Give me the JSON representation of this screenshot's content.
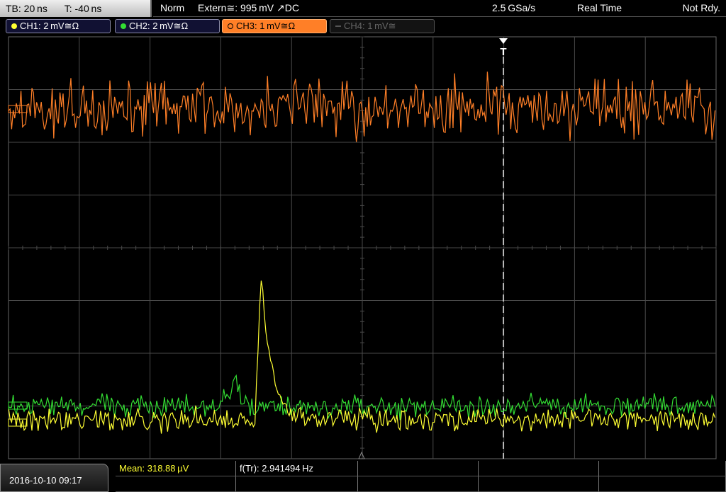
{
  "topbar": {
    "timebase": "TB: 20 ns",
    "trigger_time": "T: -40 ns",
    "mode": "Norm",
    "trigger": "Extern≅: 995 mV ↗DC",
    "sample_rate": "2.5 GSa/s",
    "acquisition": "Real Time",
    "status": "Not Rdy."
  },
  "channels": [
    {
      "label": "CH1: 2 mV≅Ω",
      "color": "#ffff33",
      "active": true
    },
    {
      "label": "CH2: 2 mV≅Ω",
      "color": "#33dd33",
      "active": true
    },
    {
      "label": "CH3: 1 mV≅Ω",
      "color": "#ff7f27",
      "active": true,
      "selected": true
    },
    {
      "label": "CH4: 1 mV≅",
      "color": "#555555",
      "active": false
    }
  ],
  "trigger_marker": "T",
  "bottom": {
    "datetime": "2016-10-10 09:17",
    "mean": "Mean: 318.88 µV",
    "frequency": "f(Tr): 2.941494 Hz"
  },
  "colors": {
    "ch1": "#ffff33",
    "ch2": "#33dd33",
    "ch3": "#ff7f27",
    "grid": "#4a4a4a",
    "trigger_line": "#ffffff"
  }
}
